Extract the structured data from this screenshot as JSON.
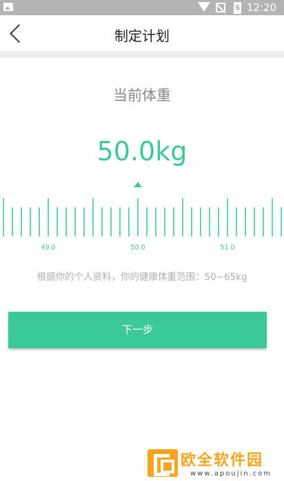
{
  "status_bar": {
    "time": "12:20",
    "battery_glyph": "$",
    "icons": [
      "image-icon",
      "wifi-icon",
      "no-signal-icon",
      "battery-icon"
    ]
  },
  "header": {
    "title": "制定计划",
    "back_icon": "chevron-left-icon"
  },
  "main": {
    "section_title": "当前体重",
    "weight_value": "50.0kg",
    "ruler": {
      "min": 48.5,
      "max": 51.5,
      "current": 50.0,
      "labels": [
        "49.0",
        "50.0",
        "51.0"
      ],
      "accent": "#3cc99a"
    },
    "hint": "根据你的个人资料，你的健康体重范围：50~65kg",
    "next_button": "下一步"
  },
  "watermark": {
    "text": "欧全软件园",
    "url": "www.apoujin.com"
  },
  "colors": {
    "accent": "#3cc99a",
    "status_bar": "#b3b3b3",
    "watermark": "#f7a51c"
  }
}
